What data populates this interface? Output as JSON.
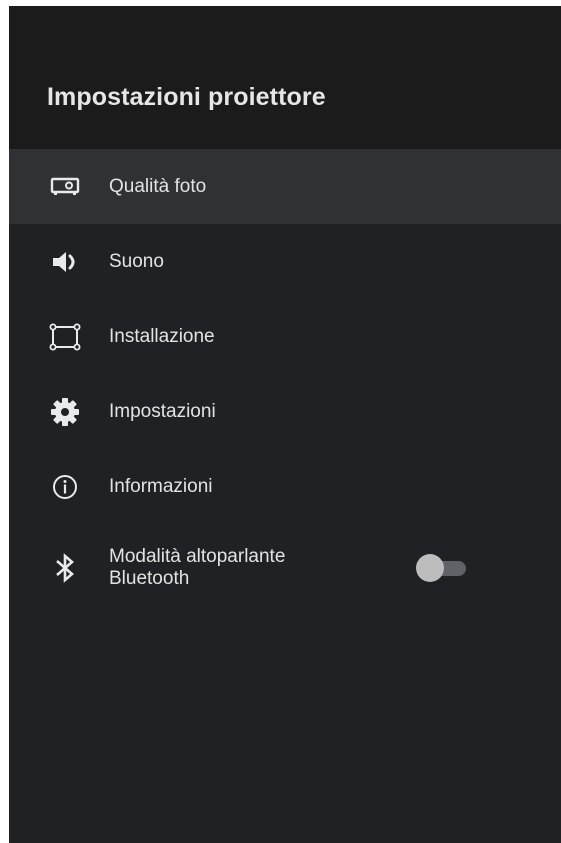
{
  "header": {
    "title": "Impostazioni proiettore"
  },
  "menu": {
    "items": [
      {
        "label": "Qualità foto",
        "icon": "projector-icon",
        "selected": true
      },
      {
        "label": "Suono",
        "icon": "speaker-icon"
      },
      {
        "label": "Installazione",
        "icon": "frame-corners-icon"
      },
      {
        "label": "Impostazioni",
        "icon": "gear-icon"
      },
      {
        "label": "Informazioni",
        "icon": "info-icon"
      },
      {
        "label": "Modalità altoparlante Bluetooth",
        "icon": "bluetooth-icon",
        "toggle": false
      }
    ]
  },
  "colors": {
    "background": "#202124",
    "header_background": "#1b1b1b",
    "selected_row": "#303134",
    "text": "#e3e3e3",
    "toggle_track": "#5f6368",
    "toggle_thumb": "#bdbdbd"
  }
}
